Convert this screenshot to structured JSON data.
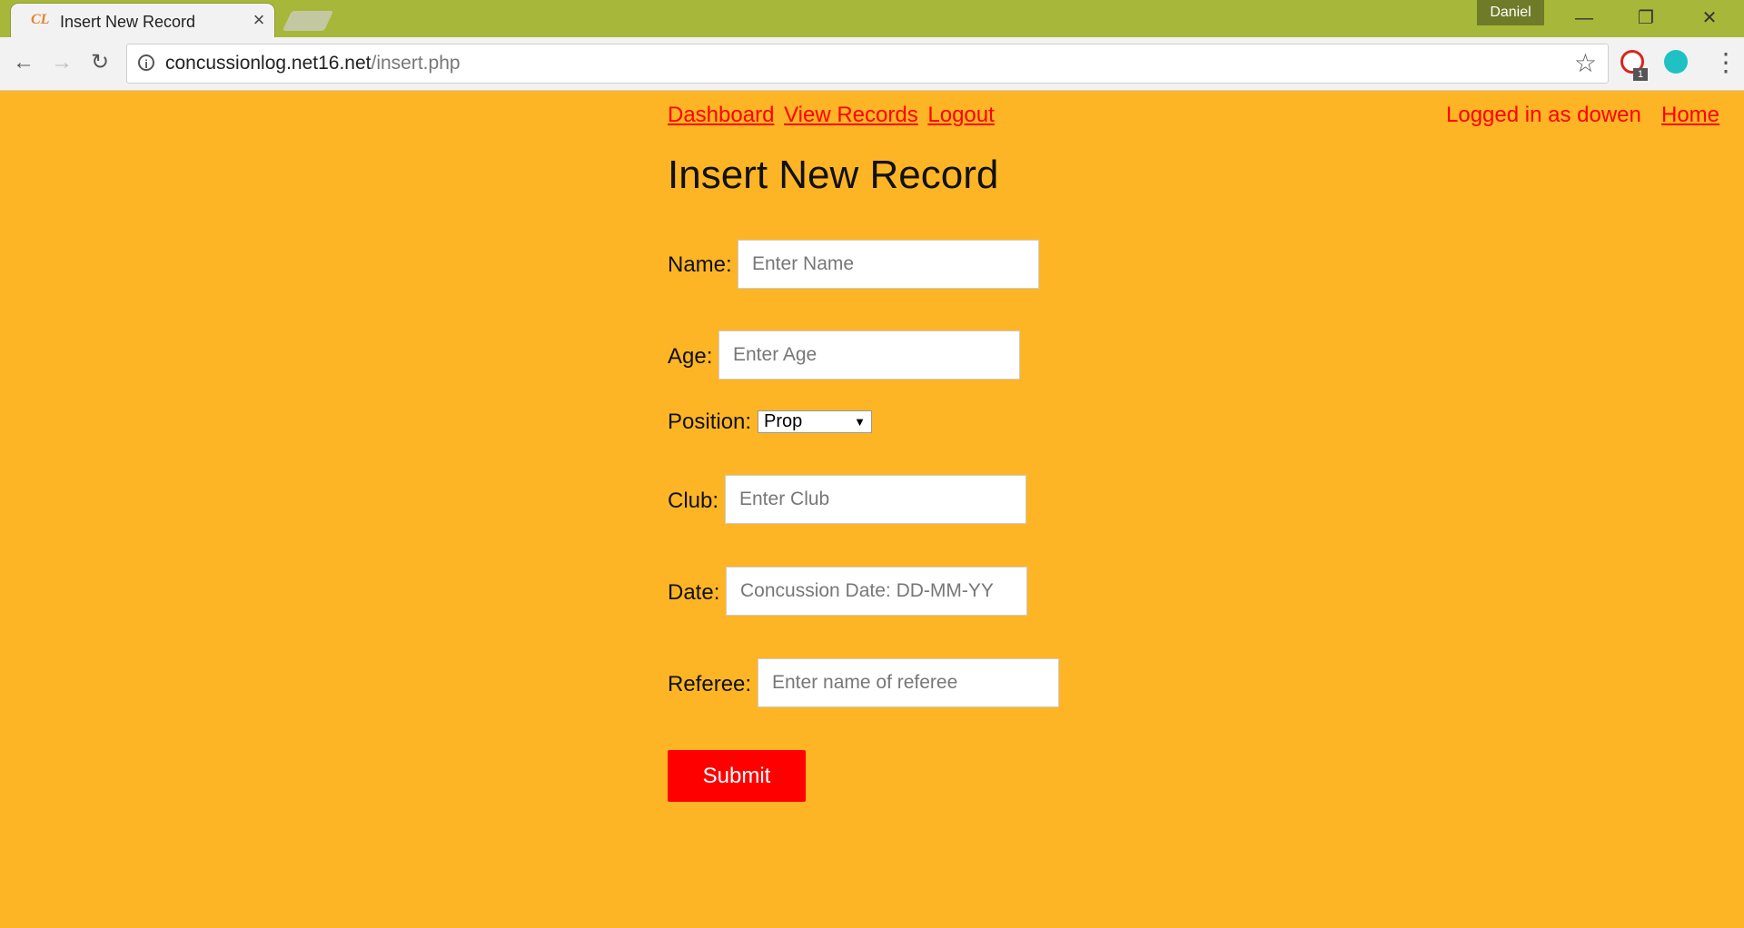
{
  "browser": {
    "tab_title": "Insert New Record",
    "favicon_text": "CL",
    "profile_name": "Daniel",
    "url_host": "concussionlog.net16.net",
    "url_path": "/insert.php",
    "extension_badge": "1",
    "icons": [
      "back-icon",
      "forward-icon",
      "reload-icon",
      "info-icon",
      "star-icon",
      "menu-icon",
      "close-icon",
      "minimize-icon",
      "restore-icon"
    ]
  },
  "nav": {
    "links": [
      "Dashboard",
      "View Records",
      "Logout"
    ],
    "logged_in": "Logged in as dowen",
    "home": "Home"
  },
  "page": {
    "title": "Insert New Record"
  },
  "form": {
    "name": {
      "label": "Name:",
      "placeholder": "Enter Name"
    },
    "age": {
      "label": "Age:",
      "placeholder": "Enter Age"
    },
    "position": {
      "label": "Position:",
      "selected": "Prop"
    },
    "club": {
      "label": "Club:",
      "placeholder": "Enter Club"
    },
    "date": {
      "label": "Date:",
      "placeholder": "Concussion Date: DD-MM-YY"
    },
    "referee": {
      "label": "Referee:",
      "placeholder": "Enter name of referee"
    },
    "submit": "Submit"
  },
  "colors": {
    "page_bg": "#FDB525",
    "link": "#FF0000",
    "button": "#FF0000",
    "titlebar": "#A6B73A"
  }
}
